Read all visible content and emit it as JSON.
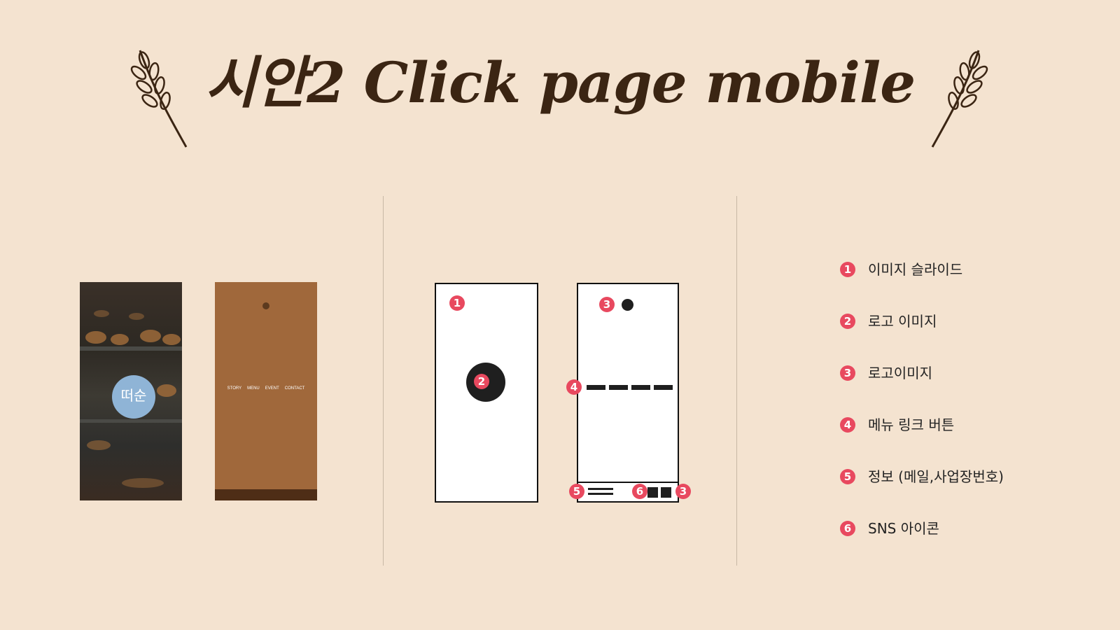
{
  "header": {
    "title": "시안2  Click page mobile"
  },
  "colors": {
    "background": "#f4e3d0",
    "title": "#3b2513",
    "badge": "#e8495f",
    "accent_brown": "#a0683b"
  },
  "icons": {
    "wheat_left": "wheat-icon",
    "wheat_right": "wheat-icon"
  },
  "preview": {
    "slide_logo": "떠순",
    "menu_items": [
      "STORY",
      "MENU",
      "EVENT",
      "CONTACT"
    ]
  },
  "wireframe": {
    "markers": [
      "1",
      "2",
      "3",
      "4",
      "5",
      "6",
      "3"
    ]
  },
  "legend": {
    "items": [
      {
        "num": "1",
        "label": "이미지 슬라이드"
      },
      {
        "num": "2",
        "label": "로고 이미지"
      },
      {
        "num": "3",
        "label": "로고이미지"
      },
      {
        "num": "4",
        "label": "메뉴 링크 버튼"
      },
      {
        "num": "5",
        "label": "정보 (메일,사업장번호)"
      },
      {
        "num": "6",
        "label": "SNS 아이콘"
      }
    ]
  }
}
